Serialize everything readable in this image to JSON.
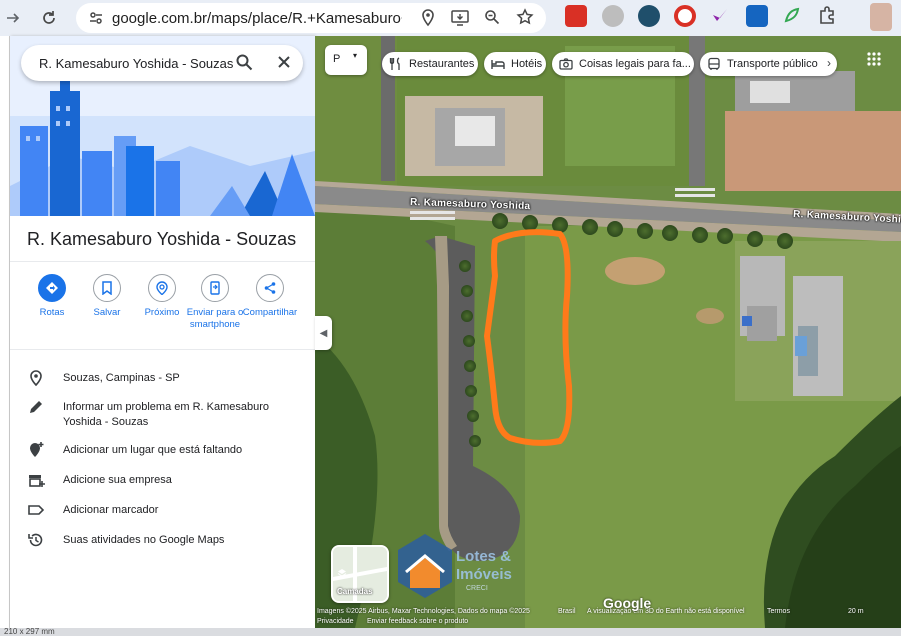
{
  "browser": {
    "url": "google.com.br/maps/place/R.+Kamesaburo+...",
    "extensions": [
      "youtube-ext-icon",
      "cloud-ext-icon",
      "lightning-ext-icon",
      "target-ext-icon",
      "feather-ext-icon",
      "newsfeed-ext-icon",
      "leaf-ext-icon",
      "puzzle-icon"
    ]
  },
  "search": {
    "query": "R. Kamesaburo Yoshida - Souzas"
  },
  "place": {
    "title": "R. Kamesaburo Yoshida - Souzas"
  },
  "actions": [
    {
      "label": "Rotas",
      "icon": "directions-icon"
    },
    {
      "label": "Salvar",
      "icon": "bookmark-icon"
    },
    {
      "label": "Próximo",
      "icon": "nearby-icon"
    },
    {
      "label": "Enviar para o smartphone",
      "icon": "send-to-phone-icon"
    },
    {
      "label": "Compartilhar",
      "icon": "share-icon"
    }
  ],
  "details": [
    {
      "text": "Souzas, Campinas - SP",
      "icon": "location-pin-icon"
    },
    {
      "text": "Informar um problema em R. Kamesaburo Yoshida - Souzas",
      "icon": "pencil-icon"
    },
    {
      "text": "Adicionar um lugar que está faltando",
      "icon": "add-place-icon"
    },
    {
      "text": "Adicione sua empresa",
      "icon": "add-business-icon"
    },
    {
      "text": "Adicionar marcador",
      "icon": "label-icon"
    },
    {
      "text": "Suas atividades no Google Maps",
      "icon": "history-icon"
    }
  ],
  "map": {
    "chips": [
      {
        "label": "Restaurantes",
        "icon": "fork-knife-icon"
      },
      {
        "label": "Hotéis",
        "icon": "bed-icon"
      },
      {
        "label": "Coisas legais para fa...",
        "icon": "camera-icon"
      },
      {
        "label": "Transporte público",
        "icon": "bus-icon"
      }
    ],
    "layer_select_label": "P",
    "layers_label": "Camadas",
    "street_label_1": "R. Kamesaburo Yoshida",
    "street_label_2": "R. Kamesaburo Yoshida",
    "google_logo": "Google",
    "attribution": {
      "imagery": "Imagens ©2025 Airbus, Maxar Technologies, Dados do mapa ©2025",
      "country": "Brasil",
      "notice": "A visualização em 3D do Earth não está disponível",
      "terms": "Termos",
      "scale": "20 m",
      "privacy": "Privacidade",
      "feedback": "Enviar feedback sobre o produto"
    },
    "watermark_line1": "Lotes &",
    "watermark_line2": "Imóveis",
    "watermark_line3": "CRECI"
  },
  "bottom": {
    "page_size": "210 x 297 mm"
  },
  "colors": {
    "accent": "#1a73e8",
    "outline": "#ff7a1a"
  }
}
